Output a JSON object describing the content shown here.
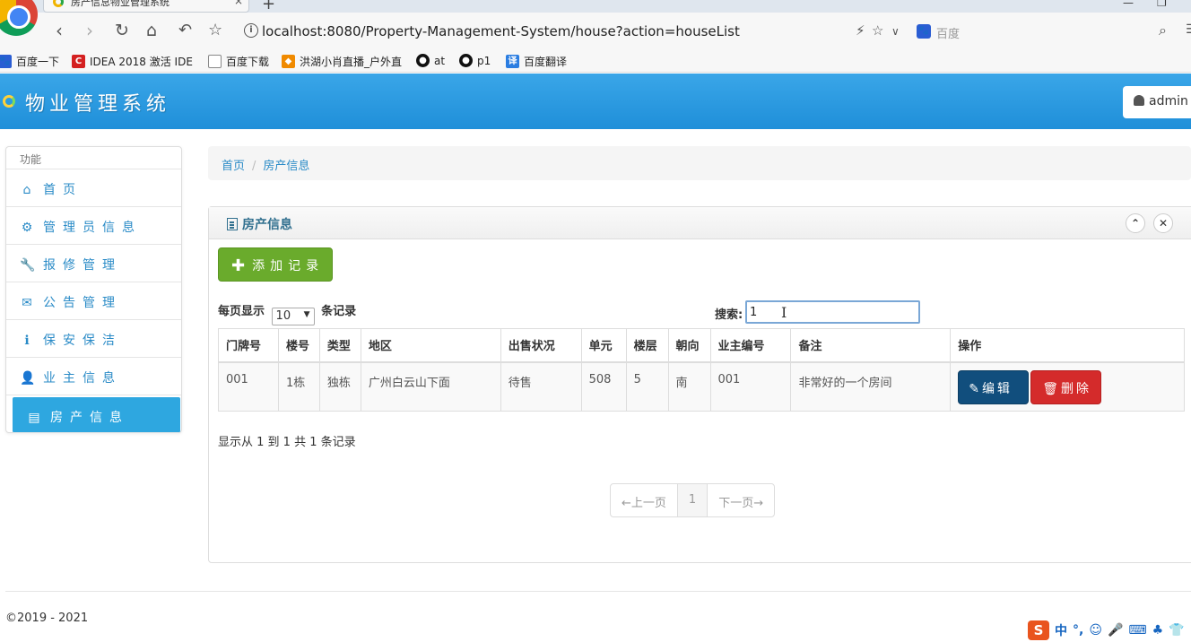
{
  "browser": {
    "tab_title": "房产信息物业管理系统",
    "tab_close": "×",
    "new_tab": "+",
    "url": "localhost:8080/Property-Management-System/house?action=houseList",
    "search_engine_label": "百度",
    "bookmarks": [
      {
        "label": "百度一下",
        "icon": "baidu-icon",
        "color": "#2a5dd3"
      },
      {
        "label": "IDEA 2018 激活 IDE",
        "icon": "idea-icon",
        "color": "#d42020"
      },
      {
        "label": "百度下载",
        "icon": "page-icon",
        "color": "#888888"
      },
      {
        "label": "洪湖小肖直播_户外直",
        "icon": "douyu-icon",
        "color": "#f08a00"
      },
      {
        "label": "at",
        "icon": "github-icon",
        "color": "#111111"
      },
      {
        "label": "p1",
        "icon": "github-icon",
        "color": "#111111"
      },
      {
        "label": "百度翻译",
        "icon": "translate-icon",
        "color": "#2a7de1"
      }
    ]
  },
  "app": {
    "brand": "物业管理系统",
    "user": "admin",
    "accent_color": "#2ea7e0"
  },
  "sidebar": {
    "header": "功能",
    "items": [
      {
        "label": "首页",
        "icon": "home-icon",
        "glyph": "⌂"
      },
      {
        "label": "管理员信息",
        "icon": "gear-icon",
        "glyph": "⚙"
      },
      {
        "label": "报修管理",
        "icon": "wrench-icon",
        "glyph": "🔧"
      },
      {
        "label": "公告管理",
        "icon": "envelope-icon",
        "glyph": "✉"
      },
      {
        "label": "保安保洁",
        "icon": "info-icon",
        "glyph": "ℹ"
      },
      {
        "label": "业主信息",
        "icon": "user-icon",
        "glyph": "👤"
      },
      {
        "label": "房产信息",
        "icon": "list-icon",
        "glyph": "▤"
      }
    ]
  },
  "breadcrumb": {
    "home": "首页",
    "sep": "/",
    "current": "房产信息"
  },
  "panel": {
    "title": "房产信息",
    "collapse_glyph": "⌃",
    "close_glyph": "✕",
    "add_button": "添加记录",
    "length_prefix": "每页显示",
    "length_value": "10",
    "length_suffix": "条记录",
    "search_label": "搜索:",
    "search_value": "1",
    "table": {
      "headers": [
        "门牌号",
        "楼号",
        "类型",
        "地区",
        "出售状况",
        "单元",
        "楼层",
        "朝向",
        "业主编号",
        "备注",
        "操作"
      ],
      "rows": [
        {
          "door": "001",
          "building": "1栋",
          "type": "独栋",
          "area": "广州白云山下面",
          "sale": "待售",
          "unit": "508",
          "floor": "5",
          "facing": "南",
          "owner": "001",
          "note": "非常好的一个房间",
          "edit": "编辑",
          "delete": "删除"
        }
      ]
    },
    "info": "显示从 1 到 1 共 1 条记录",
    "pager": {
      "prev": "←上一页",
      "current": "1",
      "next": "下一页→"
    }
  },
  "footer": {
    "copyright": "©2019 - 2021"
  },
  "ime": {
    "logo": "S",
    "mode": "中",
    "punct": "°,"
  }
}
